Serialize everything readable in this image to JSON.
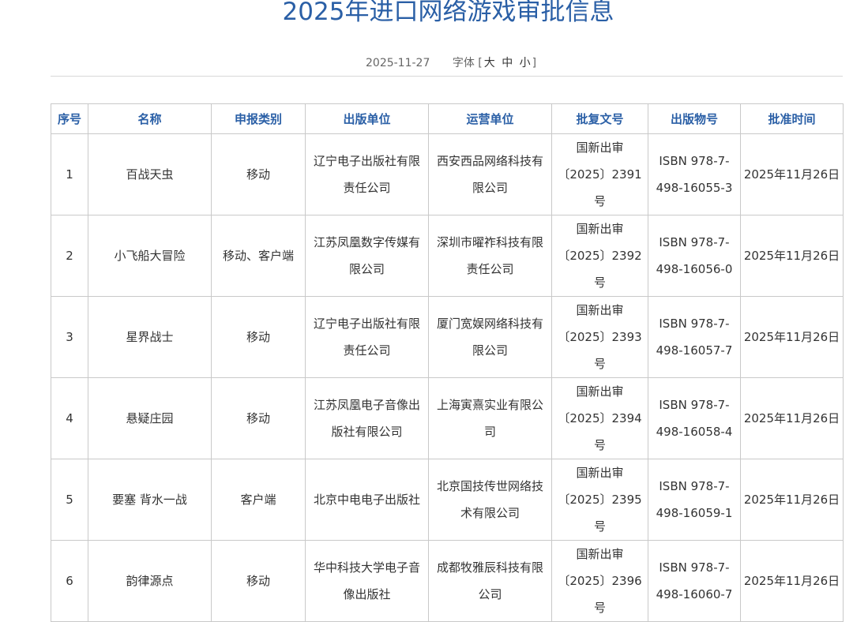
{
  "article": {
    "title": "2025年进口网络游戏审批信息",
    "date": "2025-11-27",
    "font_label": "字体",
    "bracket_open": "[",
    "bracket_close": "]",
    "font_large": "大",
    "font_medium": "中",
    "font_small": "小"
  },
  "table": {
    "headers": [
      "序号",
      "名称",
      "申报类别",
      "出版单位",
      "运营单位",
      "批复文号",
      "出版物号",
      "批准时间"
    ],
    "rows": [
      [
        "1",
        "百战天虫",
        "移动",
        "辽宁电子出版社有限责任公司",
        "西安西品网络科技有限公司",
        "国新出审〔2025〕2391号",
        "ISBN 978-7-498-16055-3",
        "2025年11月26日"
      ],
      [
        "2",
        "小飞船大冒险",
        "移动、客户端",
        "江苏凤凰数字传媒有限公司",
        "深圳市曜祚科技有限责任公司",
        "国新出审〔2025〕2392号",
        "ISBN 978-7-498-16056-0",
        "2025年11月26日"
      ],
      [
        "3",
        "星界战士",
        "移动",
        "辽宁电子出版社有限责任公司",
        "厦门宽娱网络科技有限公司",
        "国新出审〔2025〕2393号",
        "ISBN 978-7-498-16057-7",
        "2025年11月26日"
      ],
      [
        "4",
        "悬疑庄园",
        "移动",
        "江苏凤凰电子音像出版社有限公司",
        "上海寅熹实业有限公司",
        "国新出审〔2025〕2394号",
        "ISBN 978-7-498-16058-4",
        "2025年11月26日"
      ],
      [
        "5",
        "要塞 背水一战",
        "客户端",
        "北京中电电子出版社",
        "北京国技传世网络技术有限公司",
        "国新出审〔2025〕2395号",
        "ISBN 978-7-498-16059-1",
        "2025年11月26日"
      ],
      [
        "6",
        "韵律源点",
        "移动",
        "华中科技大学电子音像出版社",
        "成都牧雅辰科技有限公司",
        "国新出审〔2025〕2396号",
        "ISBN 978-7-498-16060-7",
        "2025年11月26日"
      ]
    ]
  }
}
